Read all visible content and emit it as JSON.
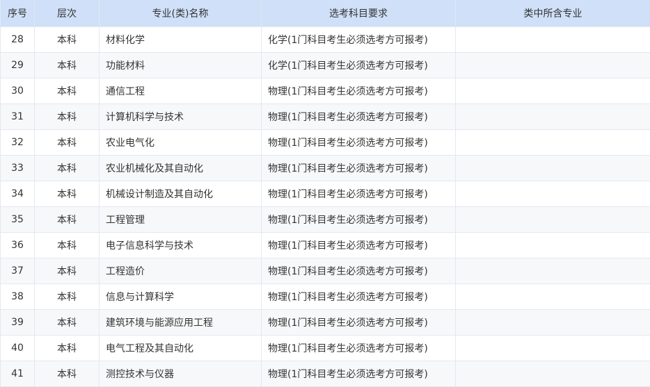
{
  "table": {
    "headers": [
      "序号",
      "层次",
      "专业(类)名称",
      "选考科目要求",
      "类中所含专业"
    ],
    "rows": [
      {
        "no": "28",
        "level": "本科",
        "major": "材料化学",
        "requirement": "化学(1门科目考生必须选考方可报考)",
        "included": ""
      },
      {
        "no": "29",
        "level": "本科",
        "major": "功能材料",
        "requirement": "化学(1门科目考生必须选考方可报考)",
        "included": ""
      },
      {
        "no": "30",
        "level": "本科",
        "major": "通信工程",
        "requirement": "物理(1门科目考生必须选考方可报考)",
        "included": ""
      },
      {
        "no": "31",
        "level": "本科",
        "major": "计算机科学与技术",
        "requirement": "物理(1门科目考生必须选考方可报考)",
        "included": ""
      },
      {
        "no": "32",
        "level": "本科",
        "major": "农业电气化",
        "requirement": "物理(1门科目考生必须选考方可报考)",
        "included": ""
      },
      {
        "no": "33",
        "level": "本科",
        "major": "农业机械化及其自动化",
        "requirement": "物理(1门科目考生必须选考方可报考)",
        "included": ""
      },
      {
        "no": "34",
        "level": "本科",
        "major": "机械设计制造及其自动化",
        "requirement": "物理(1门科目考生必须选考方可报考)",
        "included": ""
      },
      {
        "no": "35",
        "level": "本科",
        "major": "工程管理",
        "requirement": "物理(1门科目考生必须选考方可报考)",
        "included": ""
      },
      {
        "no": "36",
        "level": "本科",
        "major": "电子信息科学与技术",
        "requirement": "物理(1门科目考生必须选考方可报考)",
        "included": ""
      },
      {
        "no": "37",
        "level": "本科",
        "major": "工程造价",
        "requirement": "物理(1门科目考生必须选考方可报考)",
        "included": ""
      },
      {
        "no": "38",
        "level": "本科",
        "major": "信息与计算科学",
        "requirement": "物理(1门科目考生必须选考方可报考)",
        "included": ""
      },
      {
        "no": "39",
        "level": "本科",
        "major": "建筑环境与能源应用工程",
        "requirement": "物理(1门科目考生必须选考方可报考)",
        "included": ""
      },
      {
        "no": "40",
        "level": "本科",
        "major": "电气工程及其自动化",
        "requirement": "物理(1门科目考生必须选考方可报考)",
        "included": ""
      },
      {
        "no": "41",
        "level": "本科",
        "major": "测控技术与仪器",
        "requirement": "物理(1门科目考生必须选考方可报考)",
        "included": ""
      }
    ]
  },
  "colors": {
    "header_bg": "#cfe0f8",
    "row_alt_bg": "#f7f8fa",
    "border": "#e3e8f0",
    "text": "#333333"
  }
}
